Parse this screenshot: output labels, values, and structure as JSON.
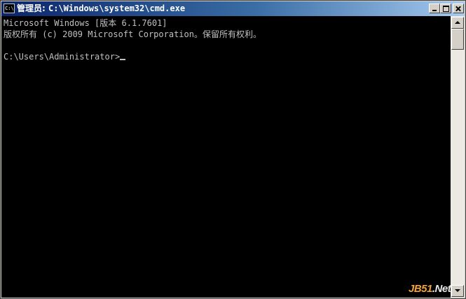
{
  "window": {
    "title_prefix": "管理员: ",
    "title_path": "C:\\Windows\\system32\\cmd.exe",
    "icon_label": "C:\\"
  },
  "console": {
    "lines": [
      "Microsoft Windows [版本 6.1.7601]",
      "版权所有 (c) 2009 Microsoft Corporation。保留所有权利。",
      ""
    ],
    "prompt": "C:\\Users\\Administrator>"
  },
  "watermark": {
    "part1": "JB51",
    "part2": ".Net"
  },
  "colors": {
    "console_background": "#000000",
    "console_text": "#c0c0c0",
    "titlebar_start": "#0a246a",
    "titlebar_end": "#a6caf0"
  },
  "icons": [
    "cmd-app-icon",
    "minimize-icon",
    "maximize-icon",
    "close-icon",
    "scroll-up-arrow-icon",
    "scroll-down-arrow-icon"
  ]
}
